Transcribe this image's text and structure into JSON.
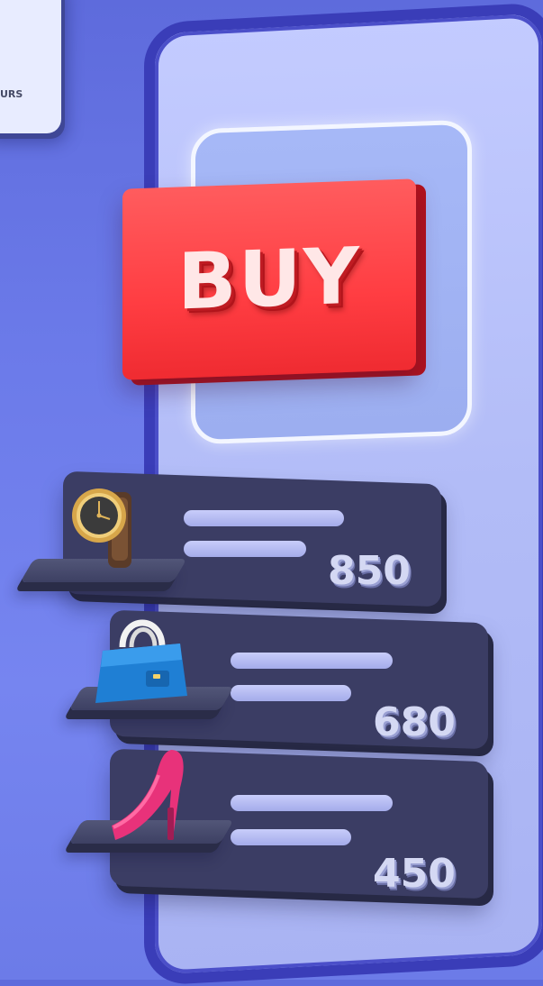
{
  "corner_card": {
    "text": "URS"
  },
  "buy_button": {
    "label": "BUY"
  },
  "products": [
    {
      "icon": "watch-icon",
      "price": "850"
    },
    {
      "icon": "handbag-icon",
      "price": "680"
    },
    {
      "icon": "high-heel-shoe-icon",
      "price": "450"
    }
  ],
  "colors": {
    "background": "#6b7ae9",
    "phone_frame": "#3a3db8",
    "phone_screen": "#b2bcf7",
    "buy_button": "#ff3d42",
    "shelf_panel": "#3b3d64"
  }
}
